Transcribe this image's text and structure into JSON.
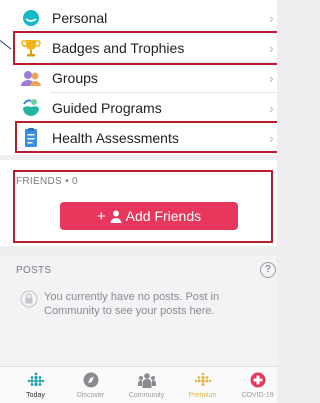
{
  "menu": {
    "items": [
      {
        "label": "Personal",
        "icon": "personal-icon"
      },
      {
        "label": "Badges and Trophies",
        "icon": "trophy-icon"
      },
      {
        "label": "Groups",
        "icon": "groups-icon"
      },
      {
        "label": "Guided Programs",
        "icon": "guided-programs-icon"
      },
      {
        "label": "Health Assessments",
        "icon": "health-assessment-icon"
      }
    ],
    "chevron": "›"
  },
  "friends": {
    "title": "FRIENDS • 0",
    "add_button": "Add Friends",
    "add_button_plus": "+"
  },
  "posts": {
    "title": "POSTS",
    "help": "?",
    "empty_message": "You currently have no posts. Post in Community to see your posts here."
  },
  "tabbar": {
    "items": [
      {
        "label": "Today",
        "icon": "today-icon",
        "active": true
      },
      {
        "label": "Discover",
        "icon": "discover-icon"
      },
      {
        "label": "Community",
        "icon": "community-icon"
      },
      {
        "label": "Premium",
        "icon": "premium-icon"
      },
      {
        "label": "COVID-19",
        "icon": "covid-icon"
      }
    ]
  },
  "colors": {
    "accent": "#e8365d",
    "highlight_box": "#b91c2a",
    "premium": "#e3b341",
    "covid": "#e8365d"
  }
}
